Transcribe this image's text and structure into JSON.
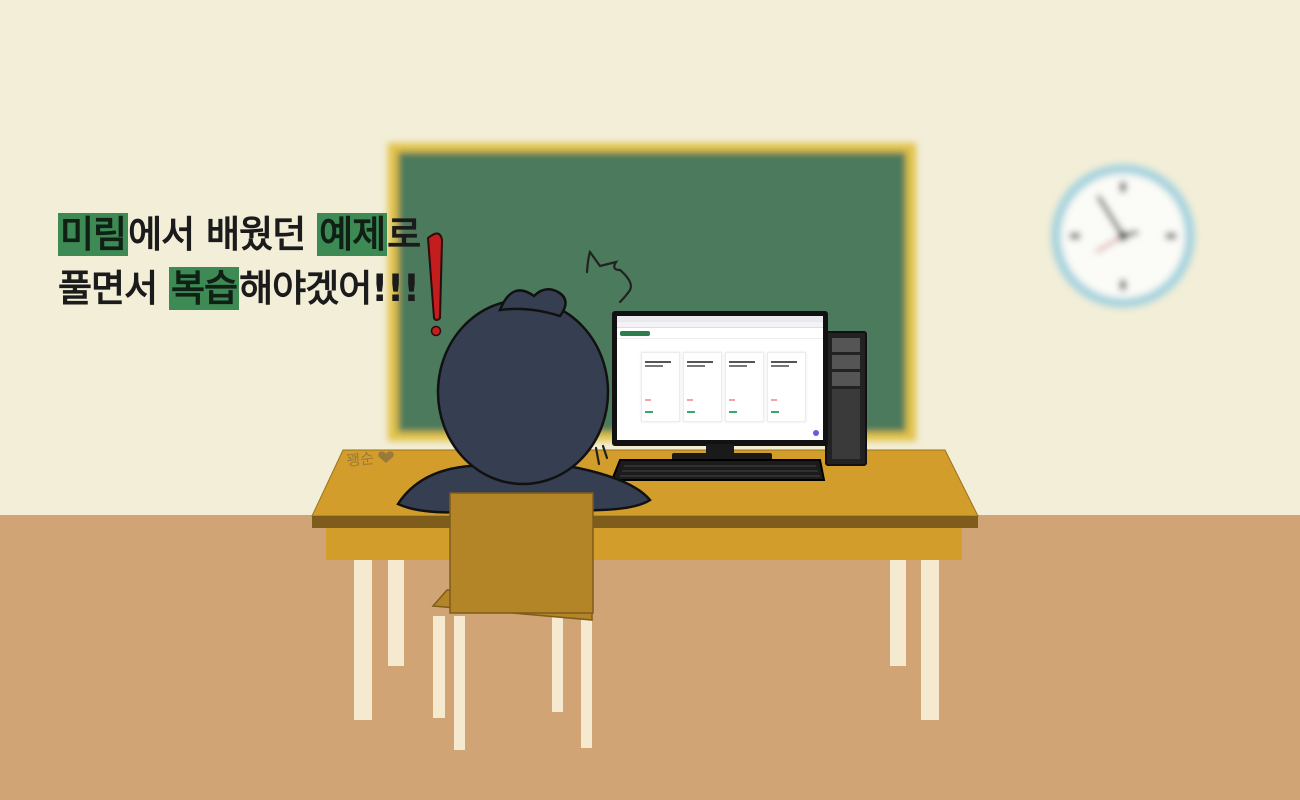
{
  "caption": {
    "line1": [
      {
        "text": "미림",
        "highlight": true
      },
      {
        "text": "에서 배웠던 ",
        "highlight": false
      },
      {
        "text": "예제",
        "highlight": true
      },
      {
        "text": "로",
        "highlight": false
      }
    ],
    "line2": [
      {
        "text": "풀면서 ",
        "highlight": false
      },
      {
        "text": "복습",
        "highlight": true
      },
      {
        "text": "해야겠어!!!",
        "highlight": false
      }
    ]
  },
  "signature": "꽹순",
  "exclamation": "!",
  "colors": {
    "wall": "#f2eed8",
    "floor": "#d0a474",
    "chalkboard": "#4b7a5c",
    "chalkboard_frame": "#e2c24a",
    "desk": "#d29d2b",
    "chair": "#b38526",
    "character": "#363f52",
    "highlight": "#3d8a55"
  },
  "icons": [
    "wall-clock-icon",
    "exclamation-icon",
    "annoyance-scribble-icon",
    "heart-icon"
  ]
}
